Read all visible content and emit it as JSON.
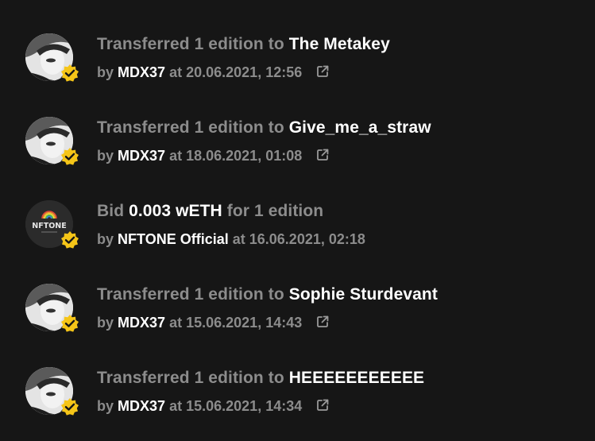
{
  "colors": {
    "background": "#161616",
    "muted_text": "#8c8c8c",
    "highlight_text": "#ffffff",
    "badge": "#f5c518"
  },
  "activity": [
    {
      "avatar": "mdx37-avatar",
      "action": "Transferred 1 edition to",
      "target": "The Metakey",
      "by_prefix": "by",
      "actor": "MDX37",
      "at_prefix": "at",
      "datetime": "20.06.2021, 12:56",
      "has_link": true,
      "link_icon": "external-link-icon"
    },
    {
      "avatar": "mdx37-avatar",
      "action": "Transferred 1 edition to",
      "target": "Give_me_a_straw",
      "by_prefix": "by",
      "actor": "MDX37",
      "at_prefix": "at",
      "datetime": "18.06.2021, 01:08",
      "has_link": true,
      "link_icon": "external-link-icon"
    },
    {
      "avatar": "nftone-avatar",
      "avatar_label": "NFTONE",
      "bid_prefix": "Bid",
      "amount": "0.003 wETH",
      "bid_suffix": "for 1 edition",
      "by_prefix": "by",
      "actor": "NFTONE Official",
      "at_prefix": "at",
      "datetime": "16.06.2021, 02:18",
      "has_link": false
    },
    {
      "avatar": "mdx37-avatar",
      "action": "Transferred 1 edition to",
      "target": "Sophie Sturdevant",
      "by_prefix": "by",
      "actor": "MDX37",
      "at_prefix": "at",
      "datetime": "15.06.2021, 14:43",
      "has_link": true,
      "link_icon": "external-link-icon"
    },
    {
      "avatar": "mdx37-avatar",
      "action": "Transferred 1 edition to",
      "target": "HEEEEEEEEEEE",
      "by_prefix": "by",
      "actor": "MDX37",
      "at_prefix": "at",
      "datetime": "15.06.2021, 14:34",
      "has_link": true,
      "link_icon": "external-link-icon"
    }
  ]
}
